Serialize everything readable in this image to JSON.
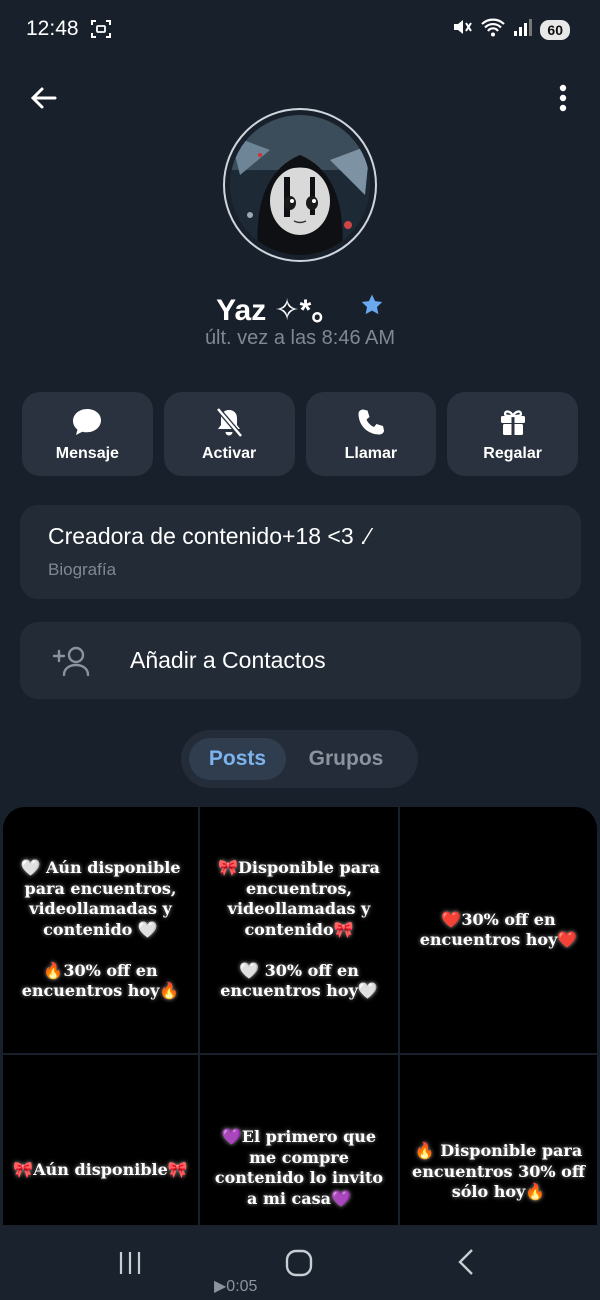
{
  "status_bar": {
    "time": "12:48",
    "battery": "60"
  },
  "profile": {
    "name": "Yaz ✧*。",
    "last_seen": "últ. vez a las 8:46 AM"
  },
  "actions": [
    {
      "label": "Mensaje",
      "icon": "chat-bubble-icon"
    },
    {
      "label": "Activar",
      "icon": "bell-off-icon"
    },
    {
      "label": "Llamar",
      "icon": "phone-icon"
    },
    {
      "label": "Regalar",
      "icon": "gift-icon"
    }
  ],
  "bio": {
    "text": "Creadora de contenido+18 <3 .⁄",
    "label": "Biografía"
  },
  "add_contact": {
    "label": "Añadir a Contactos",
    "icon": "add-person-icon"
  },
  "tabs": [
    {
      "label": "Posts",
      "active": true
    },
    {
      "label": "Grupos",
      "active": false
    }
  ],
  "posts": [
    {
      "text": "🤍 Aún disponible\npara encuentros,\nvideollamadas y\ncontenido 🤍\n\n🔥30% off en\nencuentros hoy🔥"
    },
    {
      "text": "🎀Disponible para\nencuentros,\nvideollamadas y\ncontenido🎀\n\n🤍 30% off en\nencuentros hoy🤍"
    },
    {
      "text": "❤️30% off en\nencuentros hoy❤️"
    },
    {
      "text": "🎀Aún disponible🎀"
    },
    {
      "text": "💜El primero que\nme compre\ncontenido lo invito\na mi casa💜"
    },
    {
      "text": "🔥 Disponible para\nencuentros 30% off\nsólo hoy🔥"
    }
  ],
  "video": {
    "duration": "▶0:05"
  },
  "colors": {
    "background": "#18202b",
    "card": "#222b36",
    "accent": "#7db4ee",
    "star": "#6aa8f0"
  }
}
